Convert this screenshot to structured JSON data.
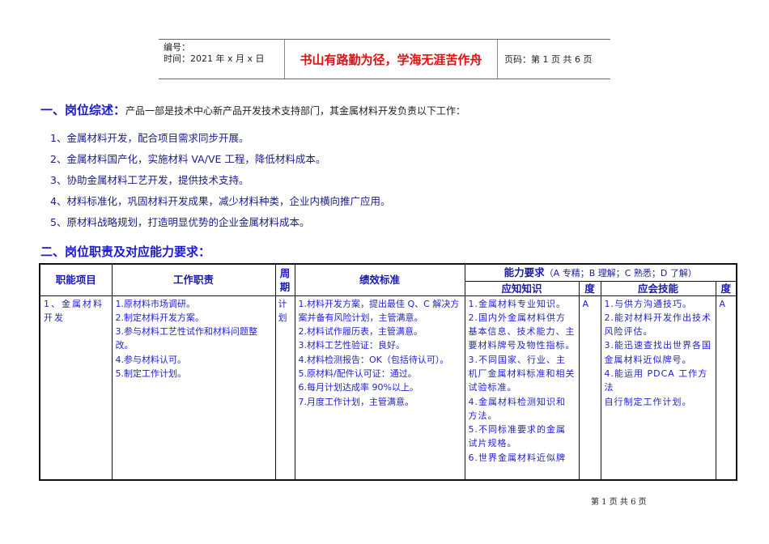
{
  "header": {
    "number_label": "编号：",
    "date_label": "时间：2021 年 x 月 x 日",
    "motto": "书山有路勤为径，学海无涯苦作舟",
    "page_code": "页码：第 1 页  共 6 页"
  },
  "section1": {
    "title": "一、岗位综述：",
    "intro": "产品一部是技术中心新产品开发技术支持部门，其金属材料开发负责以下工作：",
    "items": [
      "1、金属材料开发，配合项目需求同步开展。",
      "2、金属材料国产化，实施材料 VA/VE 工程，降低材料成本。",
      "3、协助金属材料工艺开发，提供技术支持。",
      "4、材料标准化，巩固材料开发成果，减少材料种类，企业内横向推广应用。",
      "5、原材料战略规划，打造明显优势的企业金属材料成本。"
    ]
  },
  "section2": {
    "title": "二、岗位职责及对应能力要求："
  },
  "table": {
    "headers": {
      "function": "职能项目",
      "duty": "工作职责",
      "cycle": "周期",
      "standard": "绩效标准",
      "ability": "能力要求",
      "ability_note": "（A 专精；B 理解；C 熟悉；D 了解）",
      "knowledge": "应知知识",
      "degree1": "度",
      "skill": "应会技能",
      "degree2": "度"
    },
    "row": {
      "function": "1、金属材料开发",
      "cycle": "计划",
      "duties": [
        "1.原材料市场调研。",
        "2.制定材料开发方案。",
        "3.参与材料工艺性试作和材料问题整改。",
        "4.参与材料认可。",
        "5.制定工作计划。"
      ],
      "standards": [
        "1.材料开发方案，提出最佳 Q、C 解决方案并备有风险计划，主管满意。",
        "2.材料试作履历表，主管满意。",
        "3.材料工艺性验证：良好。",
        "4.材料检测报告：OK（包括待认可）。",
        "5.原材料/配件认可证：通过。",
        "6.每月计划达成率 90%以上。",
        "7.月度工作计划，主管满意。"
      ],
      "knowledge": [
        "1.金属材料专业知识。",
        "2.国内外金属材料供方基本信息、技术能力、主要材料牌号及物性指标。",
        "3.不同国家、行业、主机厂金属材料标准和相关试验标准。",
        "4.金属材料检测知识和方法。",
        "5.不同标准要求的金属试片规格。",
        "6.世界金属材料近似牌"
      ],
      "degree1": "A",
      "skills": [
        "1.与供方沟通技巧。",
        "2.能对材料开发作出技术风险评估。",
        "3.能迅速查找出世界各国金属材料近似牌号。",
        "4.能运用 PDCA 工作方法",
        "自行制定工作计划。"
      ],
      "degree2": "A"
    }
  },
  "footer": "第 1 页 共 6 页"
}
